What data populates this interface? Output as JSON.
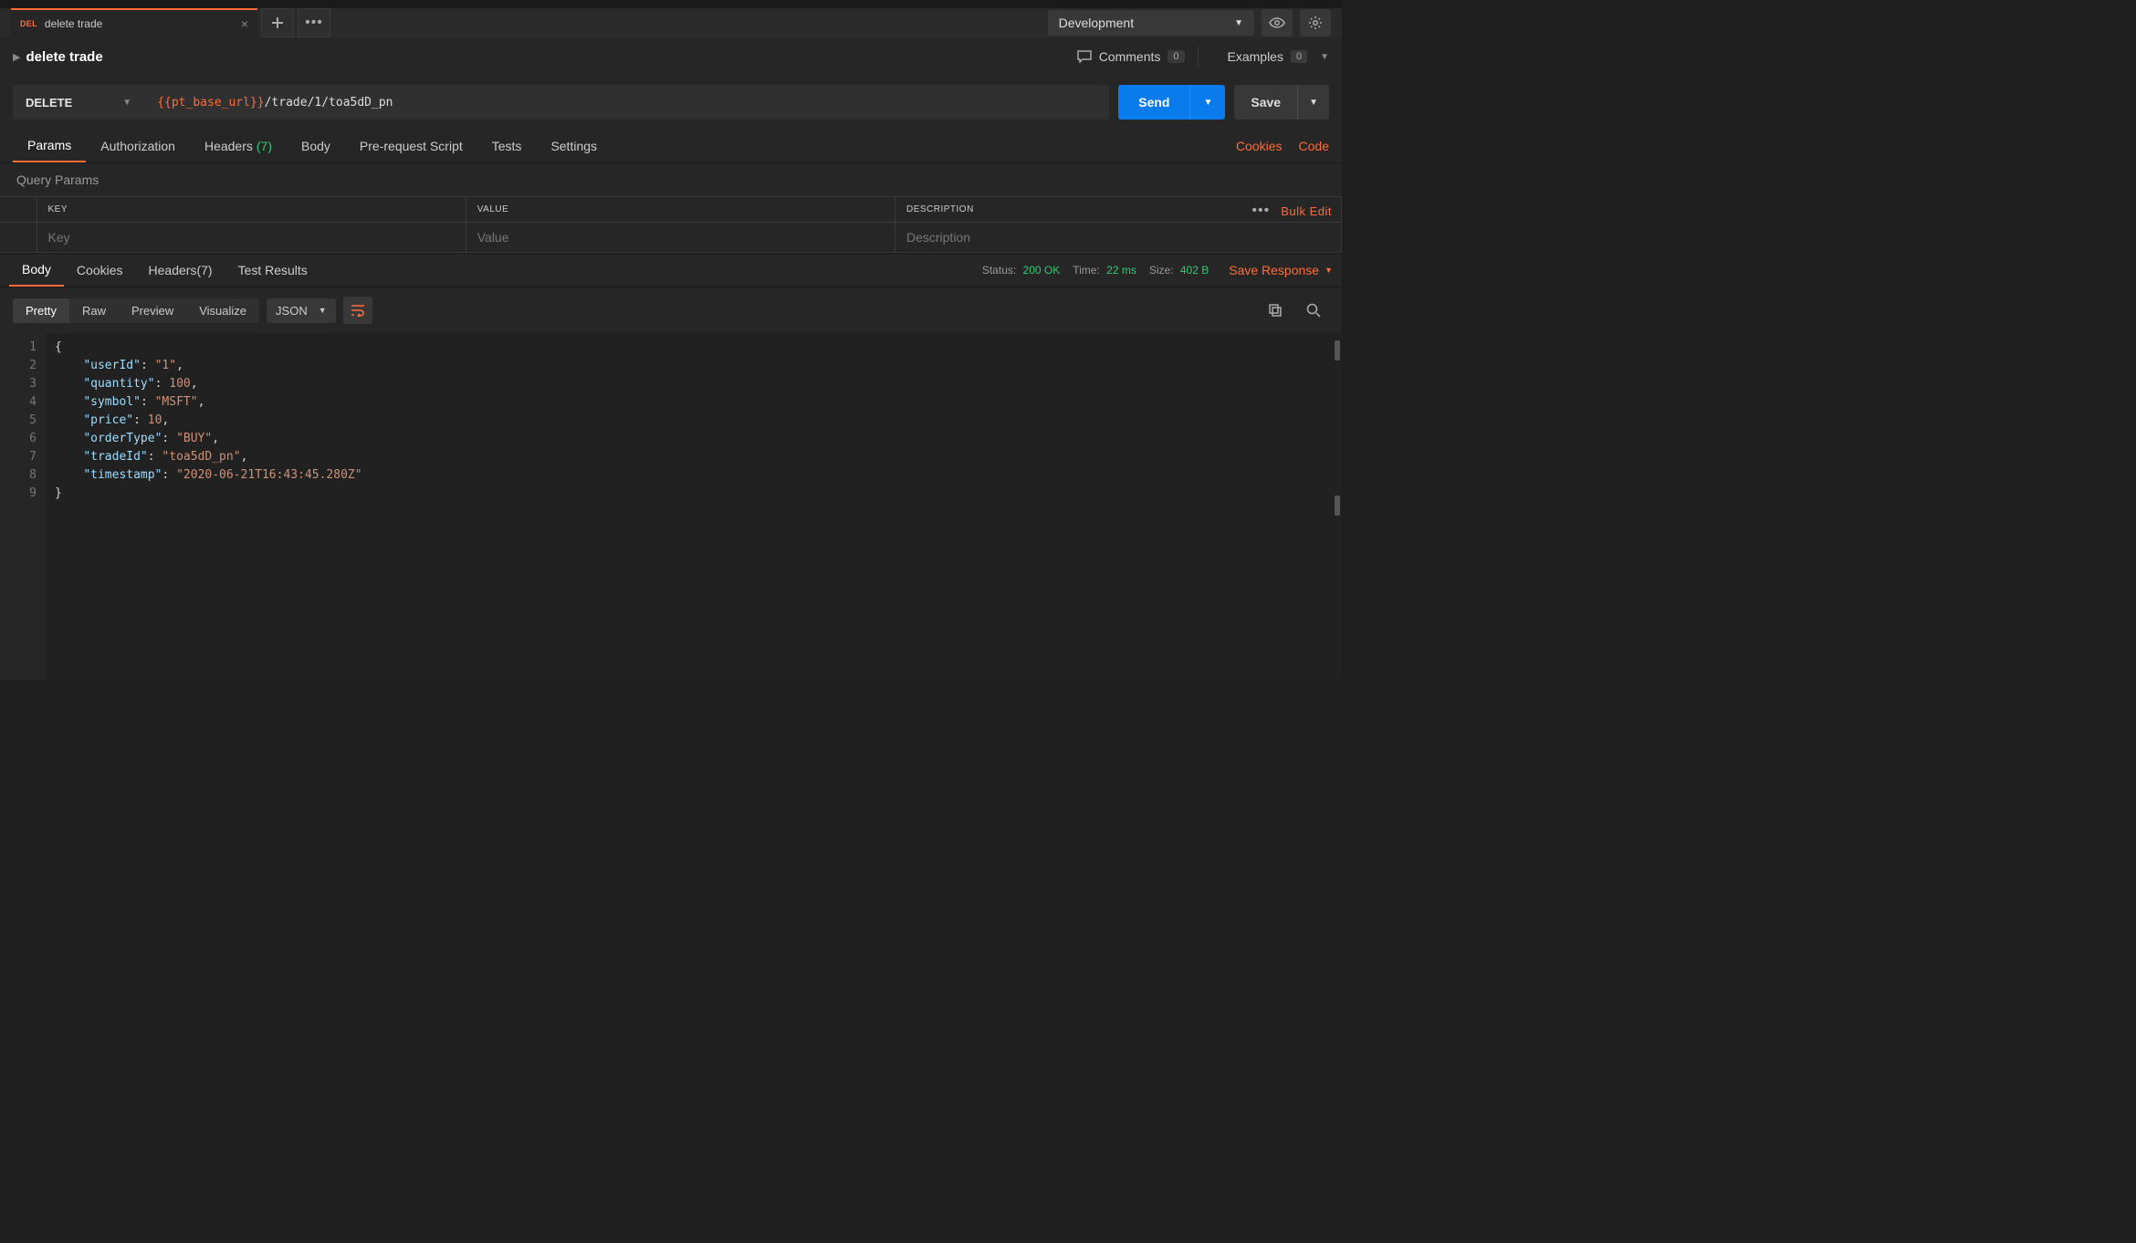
{
  "tab": {
    "method": "DEL",
    "title": "delete trade"
  },
  "env": {
    "selected": "Development"
  },
  "request": {
    "title": "delete trade",
    "comments_label": "Comments",
    "comments_count": "0",
    "examples_label": "Examples",
    "examples_count": "0",
    "method": "DELETE",
    "url_var": "{{pt_base_url}}",
    "url_path": "/trade/1/toa5dD_pn",
    "send_label": "Send",
    "save_label": "Save"
  },
  "req_tabs": {
    "params": "Params",
    "authorization": "Authorization",
    "headers": "Headers",
    "headers_count": "(7)",
    "body": "Body",
    "prerequest": "Pre-request Script",
    "tests": "Tests",
    "settings": "Settings",
    "cookies_link": "Cookies",
    "code_link": "Code"
  },
  "query_params": {
    "title": "Query Params",
    "col_key": "KEY",
    "col_value": "VALUE",
    "col_desc": "DESCRIPTION",
    "ph_key": "Key",
    "ph_value": "Value",
    "ph_desc": "Description",
    "bulk_edit": "Bulk Edit"
  },
  "resp_tabs": {
    "body": "Body",
    "cookies": "Cookies",
    "headers": "Headers",
    "headers_count": "(7)",
    "test_results": "Test Results"
  },
  "resp_meta": {
    "status_label": "Status:",
    "status_value": "200 OK",
    "time_label": "Time:",
    "time_value": "22 ms",
    "size_label": "Size:",
    "size_value": "402 B",
    "save_response": "Save Response"
  },
  "resp_modes": {
    "pretty": "Pretty",
    "raw": "Raw",
    "preview": "Preview",
    "visualize": "Visualize",
    "format": "JSON"
  },
  "response_body": {
    "userId": "1",
    "quantity": 100,
    "symbol": "MSFT",
    "price": 10,
    "orderType": "BUY",
    "tradeId": "toa5dD_pn",
    "timestamp": "2020-06-21T16:43:45.280Z"
  },
  "line_numbers": [
    "1",
    "2",
    "3",
    "4",
    "5",
    "6",
    "7",
    "8",
    "9"
  ]
}
